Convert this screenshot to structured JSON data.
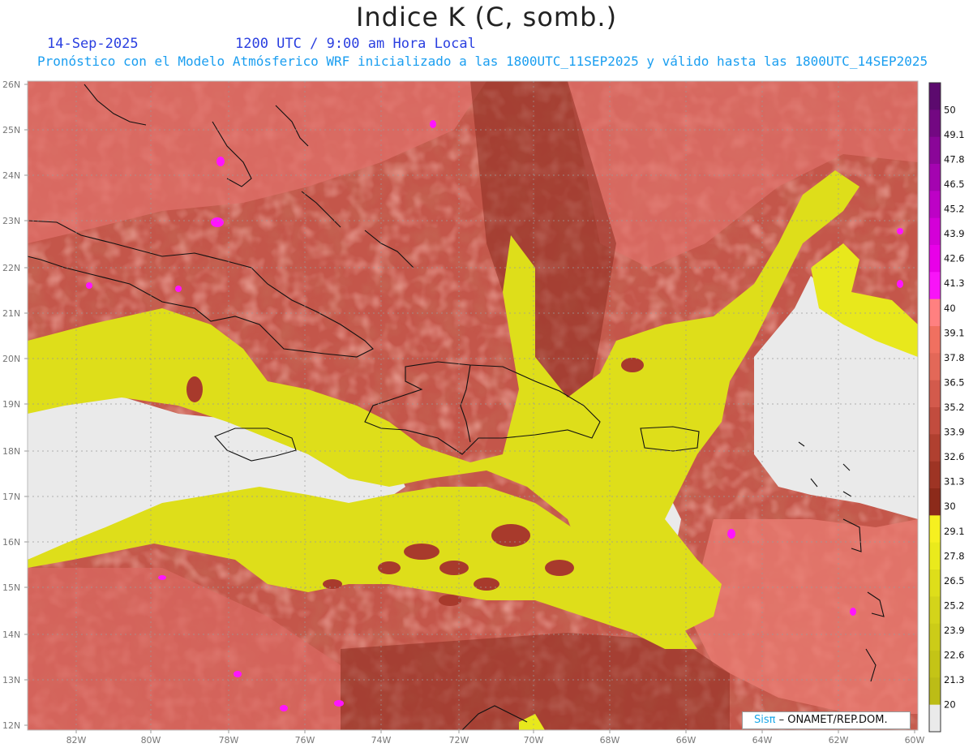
{
  "header": {
    "title": "Indice K (C, somb.)",
    "date": "14-Sep-2025",
    "valid_time": "1200 UTC / 9:00 am Hora Local",
    "forecast_info": "Pronóstico con el Modelo Atmósferico WRF inicializado a las 1800UTC_11SEP2025 y válido hasta las  1800UTC_14SEP2025"
  },
  "map": {
    "lat_labels": [
      "26N",
      "25N",
      "24N",
      "23N",
      "22N",
      "21N",
      "20N",
      "19N",
      "18N",
      "17N",
      "16N",
      "15N",
      "14N",
      "13N",
      "12N"
    ],
    "lon_labels": [
      "82W",
      "80W",
      "78W",
      "76W",
      "74W",
      "72W",
      "70W",
      "68W",
      "66W",
      "64W",
      "62W",
      "60W"
    ],
    "lat_range": [
      12,
      26
    ],
    "lon_range": [
      -83.2,
      -60
    ],
    "gridlines": true,
    "coastline_color": "#111111"
  },
  "colorbar": {
    "levels": [
      "50",
      "49.1",
      "47.8",
      "46.5",
      "45.2",
      "43.9",
      "42.6",
      "41.3",
      "40",
      "39.1",
      "37.8",
      "36.5",
      "35.2",
      "33.9",
      "32.6",
      "31.3",
      "30",
      "29.1",
      "27.8",
      "26.5",
      "25.2",
      "23.9",
      "22.6",
      "21.3",
      "20"
    ],
    "colors": [
      "#5c0a6e",
      "#730882",
      "#8a0698",
      "#a404b0",
      "#bd02c6",
      "#d400d8",
      "#e800e8",
      "#f814f8",
      "#ff8080",
      "#f07060",
      "#e36858",
      "#d35a4c",
      "#c24c3e",
      "#b04030",
      "#9e3424",
      "#8c2a1a",
      "#f6f020",
      "#eaea1c",
      "#dede1a",
      "#d4d41a",
      "#cccc18",
      "#c4c416",
      "#bcbc16",
      "#eaeaea"
    ]
  },
  "credit": {
    "brand": "Sisπ",
    "org": " – ONAMET/REP.DOM."
  },
  "colors": {
    "background_gray": "#eaeaea",
    "pink_high": "#e8706a",
    "brown_mid": "#b24a3c",
    "brown_dark": "#8c2a1a",
    "yellow_low": "#dede1a",
    "magenta_peak": "#ff14ff"
  }
}
